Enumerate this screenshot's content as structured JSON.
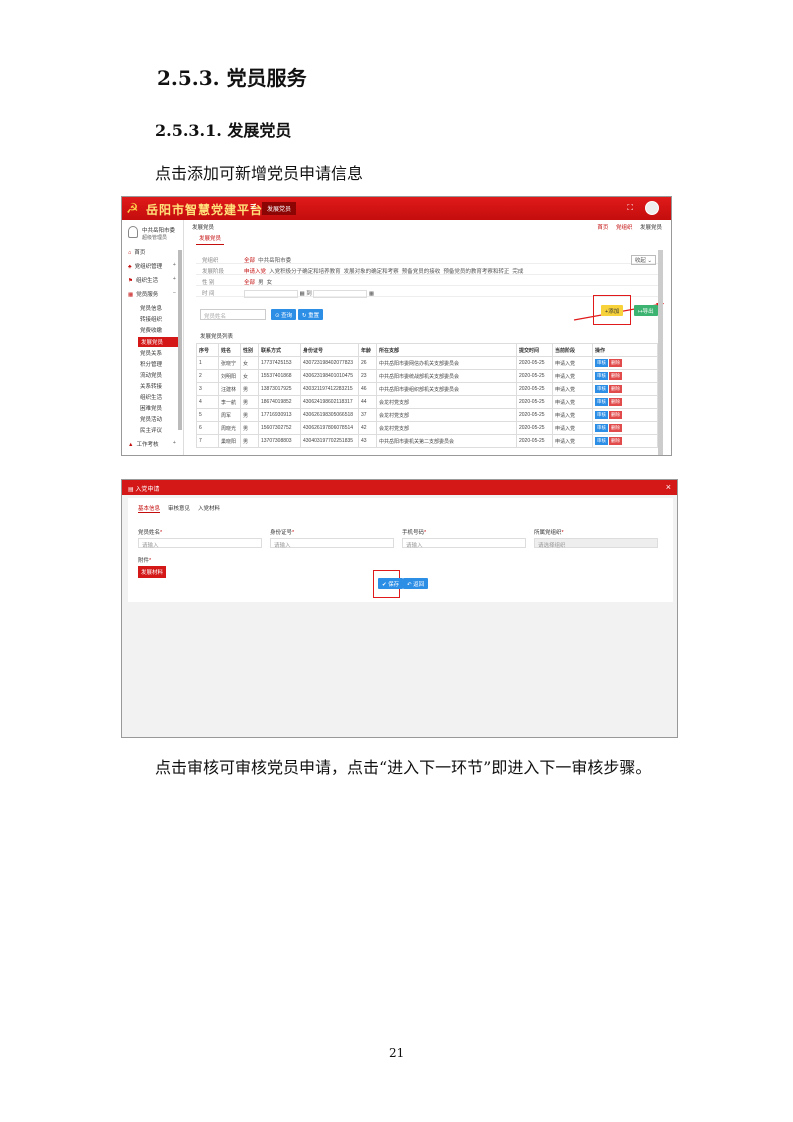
{
  "doc": {
    "heading1": "2.5.3. 党员服务",
    "heading2": "2.5.3.1. 发展党员",
    "para1": "点击添加可新增党员申请信息",
    "para2": "点击审核可审核党员申请，点击“进入下一环节”即进入下一审核步骤。",
    "page_number": "21"
  },
  "app": {
    "platform_title": "岳阳市智慧党建平台",
    "active_tab": "发展党员",
    "user_name": "中共岳阳市委",
    "user_role": "超级管理员",
    "top_links": [
      "首页",
      "党组织",
      "发展党员"
    ],
    "sidebar": [
      {
        "label": "首页"
      },
      {
        "label": "党组织管理"
      },
      {
        "label": "组织生活"
      },
      {
        "label": "党员服务"
      }
    ],
    "sidebar_sub": [
      "党员信息",
      "转接组织",
      "党费收缴",
      "发展党员",
      "党员关系",
      "积分管理",
      "流动党员",
      "关系转接",
      "组织生活",
      "困难党员",
      "党员活动",
      "民主评议"
    ],
    "sidebar_bottom": "工作考核",
    "breadcrumb": "发展党员",
    "subtab": "发展党员",
    "filters": [
      {
        "label": "党组织",
        "options": [
          "全部",
          "中共岳阳市委"
        ]
      },
      {
        "label": "发展阶段",
        "options": [
          "申请入党",
          "入党积极分子确定和培养教育",
          "发展对象的确定和考察",
          "预备党员的接收",
          "预备党员的教育考察和转正",
          "完成"
        ]
      },
      {
        "label": "性 别",
        "options": [
          "全部",
          "男",
          "女"
        ]
      },
      {
        "label": "时 间",
        "options": [
          "",
          "到",
          ""
        ]
      }
    ],
    "collapse_label": "收起",
    "search_placeholder": "党员姓名",
    "search_btn": "查询",
    "reset_btn": "重置",
    "add_btn": "添加",
    "export_btn": "导出",
    "list_title": "发展党员列表",
    "columns": [
      "序号",
      "姓名",
      "性别",
      "联系方式",
      "身份证号",
      "年龄",
      "所在支部",
      "提交时间",
      "当前阶段",
      "操作"
    ],
    "rows": [
      [
        "1",
        "张晓宁",
        "女",
        "17737425153",
        "430723198402077823",
        "26",
        "中共岳阳市委网信办机关支部委员会",
        "2020-05-25",
        "申请入党",
        "审核",
        "删除"
      ],
      [
        "2",
        "刘明阳",
        "女",
        "15537401868",
        "430623198401010475",
        "23",
        "中共岳阳市委统战部机关支部委员会",
        "2020-05-25",
        "申请入党",
        "审核",
        "删除"
      ],
      [
        "3",
        "汪建林",
        "男",
        "13873017925",
        "430321197412283215",
        "46",
        "中共岳阳市委组织部机关支部委员会",
        "2020-05-25",
        "申请入党",
        "审核",
        "删除"
      ],
      [
        "4",
        "李一航",
        "男",
        "18674019852",
        "430624198602118317",
        "44",
        "会龙村党支部",
        "2020-05-25",
        "申请入党",
        "审核",
        "删除"
      ],
      [
        "5",
        "周军",
        "男",
        "17716930913",
        "430626198305066518",
        "37",
        "会龙村党支部",
        "2020-05-25",
        "申请入党",
        "审核",
        "删除"
      ],
      [
        "6",
        "周晓光",
        "男",
        "15607302752",
        "430626197806078514",
        "42",
        "会龙村党支部",
        "2020-05-25",
        "申请入党",
        "审核",
        "删除"
      ],
      [
        "7",
        "巢晓阳",
        "男",
        "13707308803",
        "430403197702251835",
        "43",
        "中共岳阳市委机关第二支部委员会",
        "2020-05-25",
        "申请入党",
        "审核",
        "删除"
      ]
    ]
  },
  "modal": {
    "title": "入党申请",
    "tabs": [
      "基本信息",
      "审核意见",
      "入党材料"
    ],
    "fields": [
      {
        "label": "党员姓名",
        "placeholder": "请输入"
      },
      {
        "label": "身份证号",
        "placeholder": "请输入"
      },
      {
        "label": "手机号码",
        "placeholder": "请输入"
      },
      {
        "label": "所属党组织",
        "placeholder": "请选择组织"
      }
    ],
    "attachment_label": "附件",
    "upload_btn": "发展材料",
    "save_btn": "保存",
    "back_btn": "返回"
  }
}
